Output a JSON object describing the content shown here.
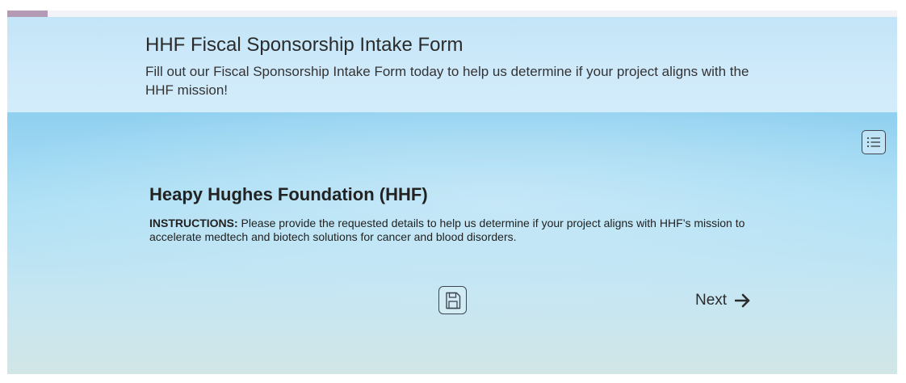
{
  "header": {
    "title": "HHF Fiscal Sponsorship Intake Form",
    "subtitle": "Fill out our Fiscal Sponsorship Intake Form today to help us determine if your project aligns with the HHF mission!"
  },
  "form": {
    "org_title": "Heapy Hughes Foundation (HHF)",
    "instructions_label": "INSTRUCTIONS:",
    "instructions_text": " Please provide the requested details to help us determine if your project aligns with HHF’s mission to accelerate medtech and biotech solutions for cancer and blood disorders."
  },
  "controls": {
    "toc_icon": "list-icon",
    "save_icon": "save-icon",
    "next_label": "Next",
    "next_icon": "arrow-right-icon"
  },
  "colors": {
    "accent": "#b49ab5",
    "header_bg": "#c3e5f8",
    "main_bg": "#8fd0f0"
  }
}
